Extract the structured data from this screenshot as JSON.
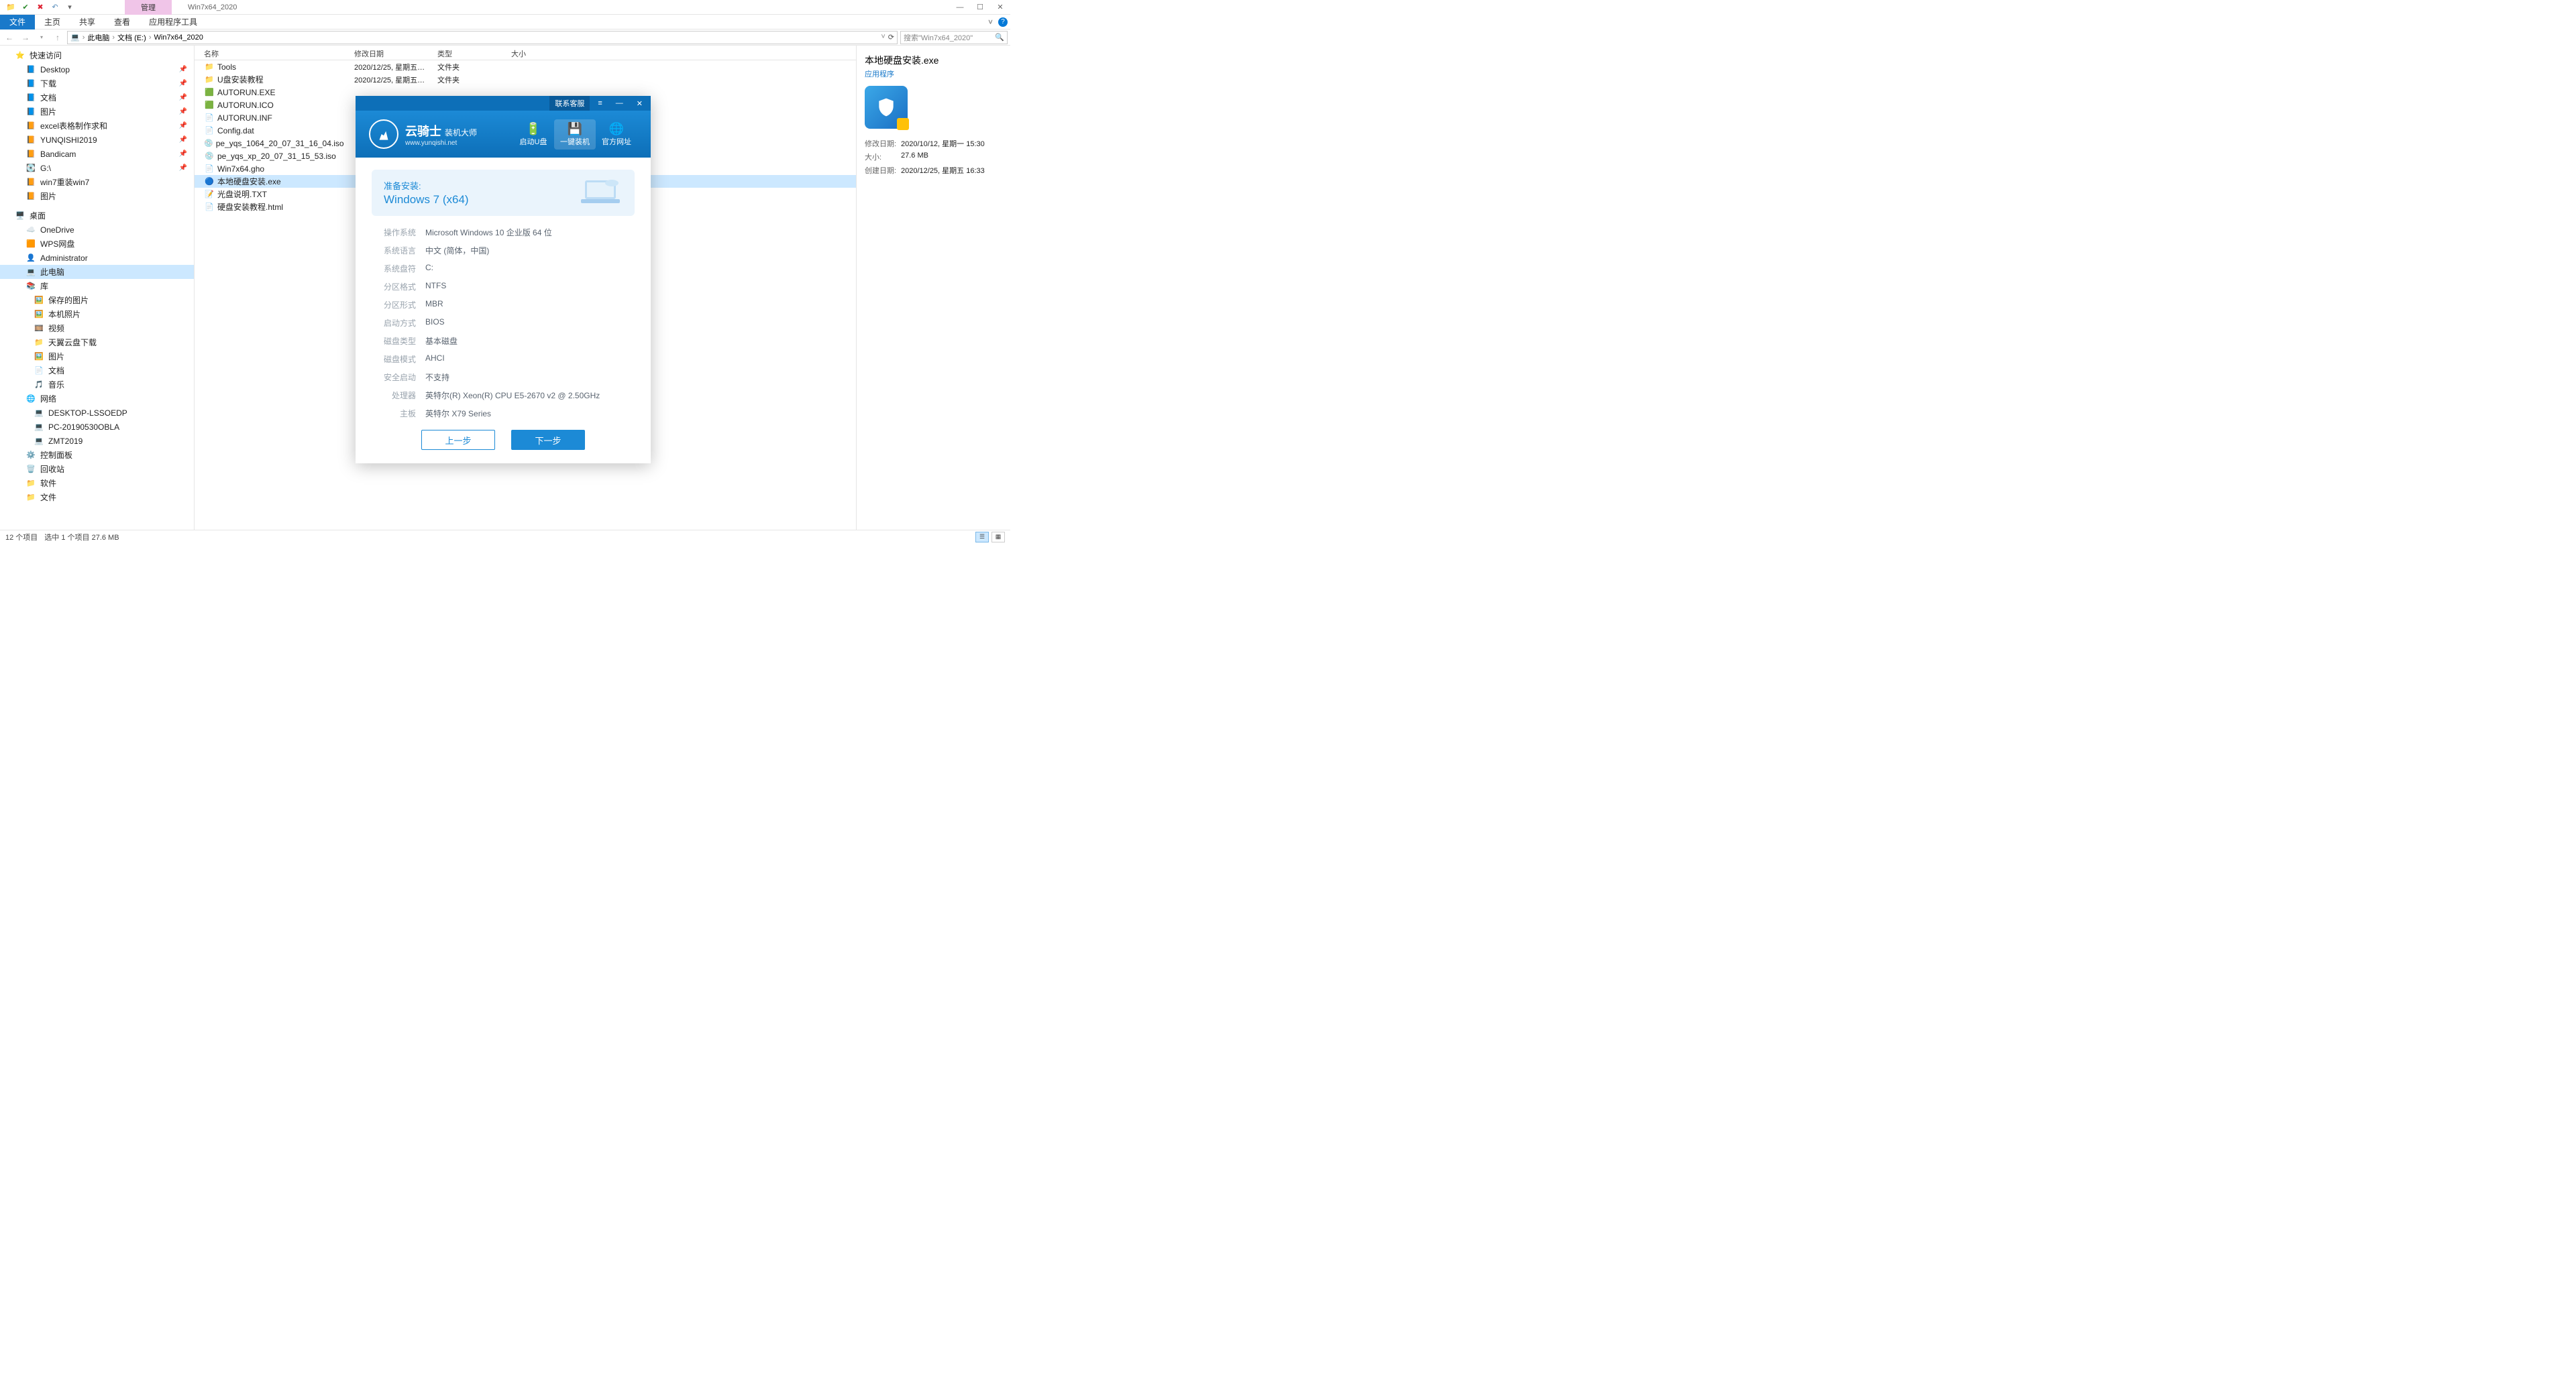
{
  "window": {
    "context_tab": "管理",
    "title": "Win7x64_2020"
  },
  "ribbon": {
    "tabs": [
      "文件",
      "主页",
      "共享",
      "查看",
      "应用程序工具"
    ],
    "active": 0
  },
  "breadcrumb": [
    "此电脑",
    "文档 (E:)",
    "Win7x64_2020"
  ],
  "search_placeholder": "搜索\"Win7x64_2020\"",
  "columns": {
    "name": "名称",
    "date": "修改日期",
    "type": "类型",
    "size": "大小"
  },
  "sidebar": {
    "quick_access": "快速访问",
    "quick_items": [
      {
        "label": "Desktop",
        "icon": "📘",
        "pin": true
      },
      {
        "label": "下载",
        "icon": "📘",
        "pin": true
      },
      {
        "label": "文档",
        "icon": "📘",
        "pin": true
      },
      {
        "label": "图片",
        "icon": "📘",
        "pin": true
      },
      {
        "label": "excel表格制作求和",
        "icon": "📙",
        "pin": true
      },
      {
        "label": "YUNQISHI2019",
        "icon": "📙",
        "pin": true
      },
      {
        "label": "Bandicam",
        "icon": "📙",
        "pin": true
      },
      {
        "label": "G:\\",
        "icon": "💽",
        "pin": true
      },
      {
        "label": "win7重装win7",
        "icon": "📙",
        "pin": false
      },
      {
        "label": "图片",
        "icon": "📙",
        "pin": false
      }
    ],
    "desktop": "桌面",
    "desktop_items": [
      {
        "label": "OneDrive",
        "icon": "☁️"
      },
      {
        "label": "WPS网盘",
        "icon": "🟧"
      },
      {
        "label": "Administrator",
        "icon": "👤"
      },
      {
        "label": "此电脑",
        "icon": "💻",
        "selected": true
      },
      {
        "label": "库",
        "icon": "📚"
      }
    ],
    "lib_items": [
      {
        "label": "保存的图片",
        "icon": "🖼️"
      },
      {
        "label": "本机照片",
        "icon": "🖼️"
      },
      {
        "label": "视频",
        "icon": "🎞️"
      },
      {
        "label": "天翼云盘下载",
        "icon": "📁"
      },
      {
        "label": "图片",
        "icon": "🖼️"
      },
      {
        "label": "文档",
        "icon": "📄"
      },
      {
        "label": "音乐",
        "icon": "🎵"
      }
    ],
    "network": "网络",
    "net_items": [
      {
        "label": "DESKTOP-LSSOEDP",
        "icon": "💻"
      },
      {
        "label": "PC-20190530OBLA",
        "icon": "💻"
      },
      {
        "label": "ZMT2019",
        "icon": "💻"
      }
    ],
    "tail_items": [
      {
        "label": "控制面板",
        "icon": "⚙️"
      },
      {
        "label": "回收站",
        "icon": "🗑️"
      },
      {
        "label": "软件",
        "icon": "📁"
      },
      {
        "label": "文件",
        "icon": "📁"
      }
    ]
  },
  "files": [
    {
      "name": "Tools",
      "date": "2020/12/25, 星期五 1…",
      "type": "文件夹",
      "icon": "📁"
    },
    {
      "name": "U盘安装教程",
      "date": "2020/12/25, 星期五 1…",
      "type": "文件夹",
      "icon": "📁"
    },
    {
      "name": "AUTORUN.EXE",
      "date": "",
      "type": "",
      "icon": "🟩"
    },
    {
      "name": "AUTORUN.ICO",
      "date": "",
      "type": "",
      "icon": "🟩"
    },
    {
      "name": "AUTORUN.INF",
      "date": "",
      "type": "",
      "icon": "📄"
    },
    {
      "name": "Config.dat",
      "date": "",
      "type": "",
      "icon": "📄"
    },
    {
      "name": "pe_yqs_1064_20_07_31_16_04.iso",
      "date": "",
      "type": "",
      "icon": "💿"
    },
    {
      "name": "pe_yqs_xp_20_07_31_15_53.iso",
      "date": "",
      "type": "",
      "icon": "💿"
    },
    {
      "name": "Win7x64.gho",
      "date": "",
      "type": "",
      "icon": "📄"
    },
    {
      "name": "本地硬盘安装.exe",
      "date": "",
      "type": "",
      "icon": "🔵",
      "selected": true
    },
    {
      "name": "光盘说明.TXT",
      "date": "",
      "type": "",
      "icon": "📝"
    },
    {
      "name": "硬盘安装教程.html",
      "date": "",
      "type": "",
      "icon": "📄"
    }
  ],
  "details": {
    "title": "本地硬盘安装.exe",
    "subtype": "应用程序",
    "rows": [
      {
        "k": "修改日期:",
        "v": "2020/10/12, 星期一 15:30"
      },
      {
        "k": "大小:",
        "v": "27.6 MB"
      },
      {
        "k": "创建日期:",
        "v": "2020/12/25, 星期五 16:33"
      }
    ]
  },
  "status": {
    "count": "12 个项目",
    "selection": "选中 1 个项目  27.6 MB"
  },
  "installer": {
    "titlebar": {
      "contact": "联系客服"
    },
    "brand_cn": "云骑士",
    "brand_sub": "装机大师",
    "brand_url": "www.yunqishi.net",
    "nav": [
      {
        "label": "启动U盘",
        "icon": "🔋"
      },
      {
        "label": "一键装机",
        "icon": "💾",
        "active": true
      },
      {
        "label": "官方网址",
        "icon": "🌐"
      }
    ],
    "ready_label": "准备安装:",
    "ready_os": "Windows 7 (x64)",
    "kv": [
      {
        "k": "操作系统",
        "v": "Microsoft Windows 10 企业版 64 位"
      },
      {
        "k": "系统语言",
        "v": "中文 (简体，中国)"
      },
      {
        "k": "系统盘符",
        "v": "C:"
      },
      {
        "k": "分区格式",
        "v": "NTFS"
      },
      {
        "k": "分区形式",
        "v": "MBR"
      },
      {
        "k": "启动方式",
        "v": "BIOS"
      },
      {
        "k": "磁盘类型",
        "v": "基本磁盘"
      },
      {
        "k": "磁盘模式",
        "v": "AHCI"
      },
      {
        "k": "安全启动",
        "v": "不支持"
      },
      {
        "k": "处理器",
        "v": "英特尔(R) Xeon(R) CPU E5-2670 v2 @ 2.50GHz"
      },
      {
        "k": "主板",
        "v": "英特尔 X79 Series"
      }
    ],
    "btn_prev": "上一步",
    "btn_next": "下一步"
  }
}
